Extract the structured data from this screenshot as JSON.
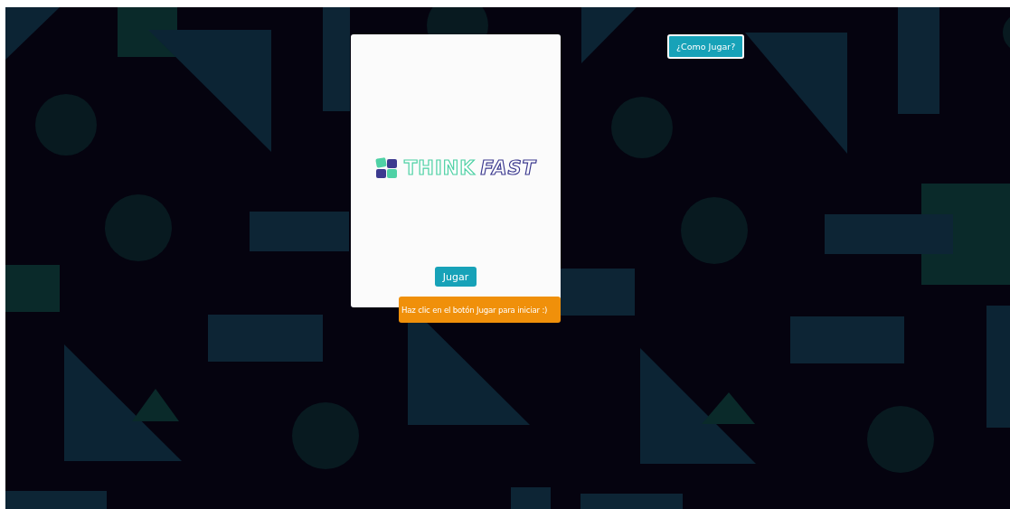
{
  "help_button": {
    "label": "¿Como Jugar?"
  },
  "card": {
    "logo": {
      "word_1": "THINK",
      "word_2": "FAST"
    },
    "play_button": {
      "label": "Jugar"
    }
  },
  "tooltip": {
    "text": "Haz clic en el botón Jugar para iniciar :)"
  }
}
